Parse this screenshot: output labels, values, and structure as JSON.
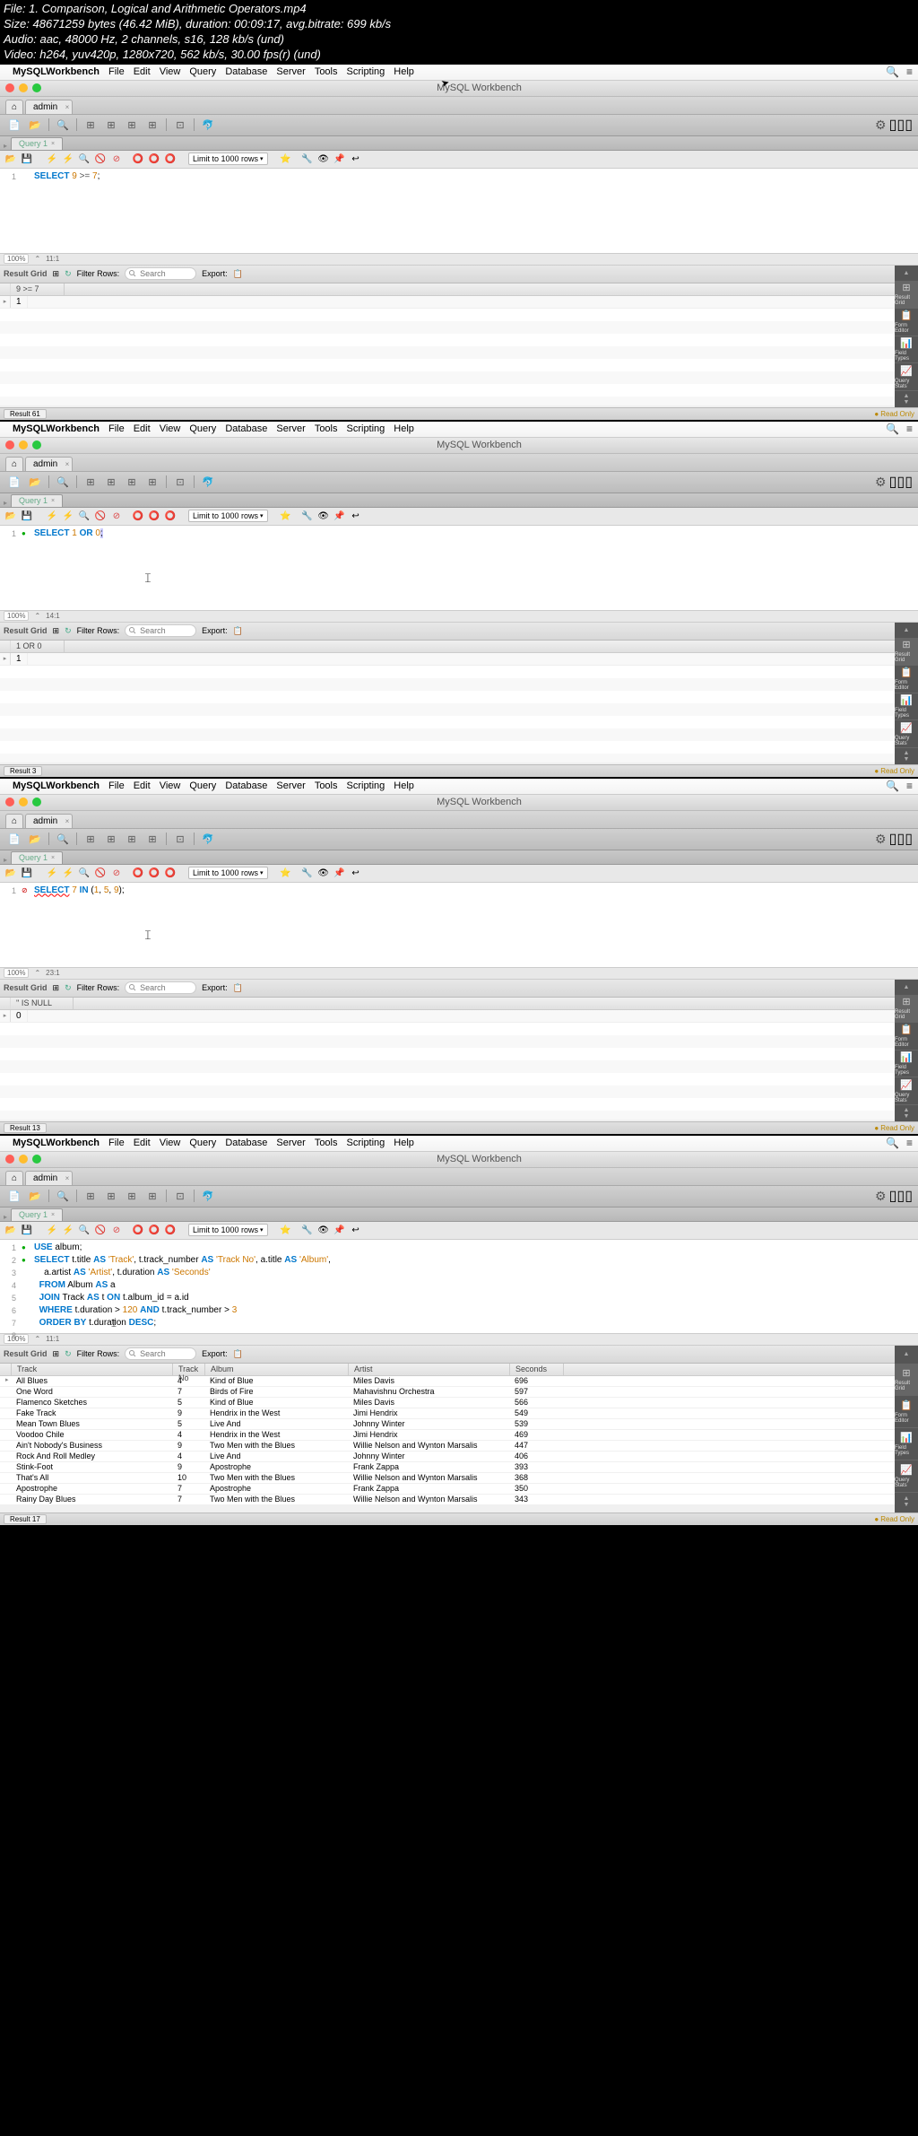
{
  "file_info": {
    "l1": "File: 1. Comparison, Logical and Arithmetic Operators.mp4",
    "l2": "Size: 48671259 bytes (46.42 MiB), duration: 00:09:17, avg.bitrate: 699 kb/s",
    "l3": "Audio: aac, 48000 Hz, 2 channels, s16, 128 kb/s (und)",
    "l4": "Video: h264, yuv420p, 1280x720, 562 kb/s, 30.00 fps(r) (und)"
  },
  "menubar": {
    "app": "MySQLWorkbench",
    "items": [
      "File",
      "Edit",
      "View",
      "Query",
      "Database",
      "Server",
      "Tools",
      "Scripting",
      "Help"
    ]
  },
  "window_title": "MySQL Workbench",
  "connection_tab": "admin",
  "query_tab": "Query 1",
  "editor_toolbar": {
    "limit": "Limit to 1000 rows"
  },
  "result_toolbar": {
    "grid": "Result Grid",
    "filter": "Filter Rows:",
    "placeholder": "Search",
    "export": "Export:"
  },
  "side_tabs": [
    "Result Grid",
    "Form Editor",
    "Field Types",
    "Query Stats"
  ],
  "shot1": {
    "timestamp": "",
    "sql_line": "SELECT 9 >= 7;",
    "status_zoom": "100%",
    "status_pos": "11:1",
    "result_header": "9 >= 7",
    "result_value": "1",
    "result_tab": "Result 61",
    "readonly": "Read Only"
  },
  "shot2": {
    "timestamp": "",
    "sql_line": "SELECT 1 OR 0;",
    "status_zoom": "100%",
    "status_pos": "14:1",
    "result_header": "1 OR 0",
    "result_value": "1",
    "result_tab": "Result 3",
    "readonly": "Read Only"
  },
  "shot3": {
    "timestamp": "",
    "sql_line": "SELECT 7 IN (1, 5, 9);",
    "status_zoom": "100%",
    "status_pos": "23:1",
    "result_header": "'' IS NULL",
    "result_value": "0",
    "result_tab": "Result 13",
    "readonly": "Read Only"
  },
  "shot4": {
    "timestamp": "",
    "sql": {
      "l1": "USE album;",
      "l2": "SELECT t.title AS 'Track', t.track_number AS 'Track No', a.title AS 'Album',",
      "l3": "       a.artist AS 'Artist', t.duration AS 'Seconds'",
      "l4": "  FROM Album AS a",
      "l5": "  JOIN Track AS t ON t.album_id = a.id",
      "l6": "  WHERE t.duration > 120 AND t.track_number > 3",
      "l7": "  ORDER BY t.duration DESC;"
    },
    "status_zoom": "100%",
    "status_pos": "11:1",
    "columns": [
      "Track",
      "Track No",
      "Album",
      "Artist",
      "Seconds"
    ],
    "rows": [
      [
        "All Blues",
        "4",
        "Kind of Blue",
        "Miles Davis",
        "696"
      ],
      [
        "One Word",
        "7",
        "Birds of Fire",
        "Mahavishnu Orchestra",
        "597"
      ],
      [
        "Flamenco Sketches",
        "5",
        "Kind of Blue",
        "Miles Davis",
        "566"
      ],
      [
        "Fake Track",
        "9",
        "Hendrix in the West",
        "Jimi Hendrix",
        "549"
      ],
      [
        "Mean Town Blues",
        "5",
        "Live And",
        "Johnny Winter",
        "539"
      ],
      [
        "Voodoo Chile",
        "4",
        "Hendrix in the West",
        "Jimi Hendrix",
        "469"
      ],
      [
        "Ain't Nobody's Business",
        "9",
        "Two Men with the Blues",
        "Willie Nelson and Wynton Marsalis",
        "447"
      ],
      [
        "Rock And Roll Medley",
        "4",
        "Live And",
        "Johnny Winter",
        "406"
      ],
      [
        "Stink-Foot",
        "9",
        "Apostrophe",
        "Frank Zappa",
        "393"
      ],
      [
        "That's All",
        "10",
        "Two Men with the Blues",
        "Willie Nelson and Wynton Marsalis",
        "368"
      ],
      [
        "Apostrophe",
        "7",
        "Apostrophe",
        "Frank Zappa",
        "350"
      ],
      [
        "Rainy Day Blues",
        "7",
        "Two Men with the Blues",
        "Willie Nelson and Wynton Marsalis",
        "343"
      ]
    ],
    "result_tab": "Result 17",
    "readonly": "Read Only"
  }
}
